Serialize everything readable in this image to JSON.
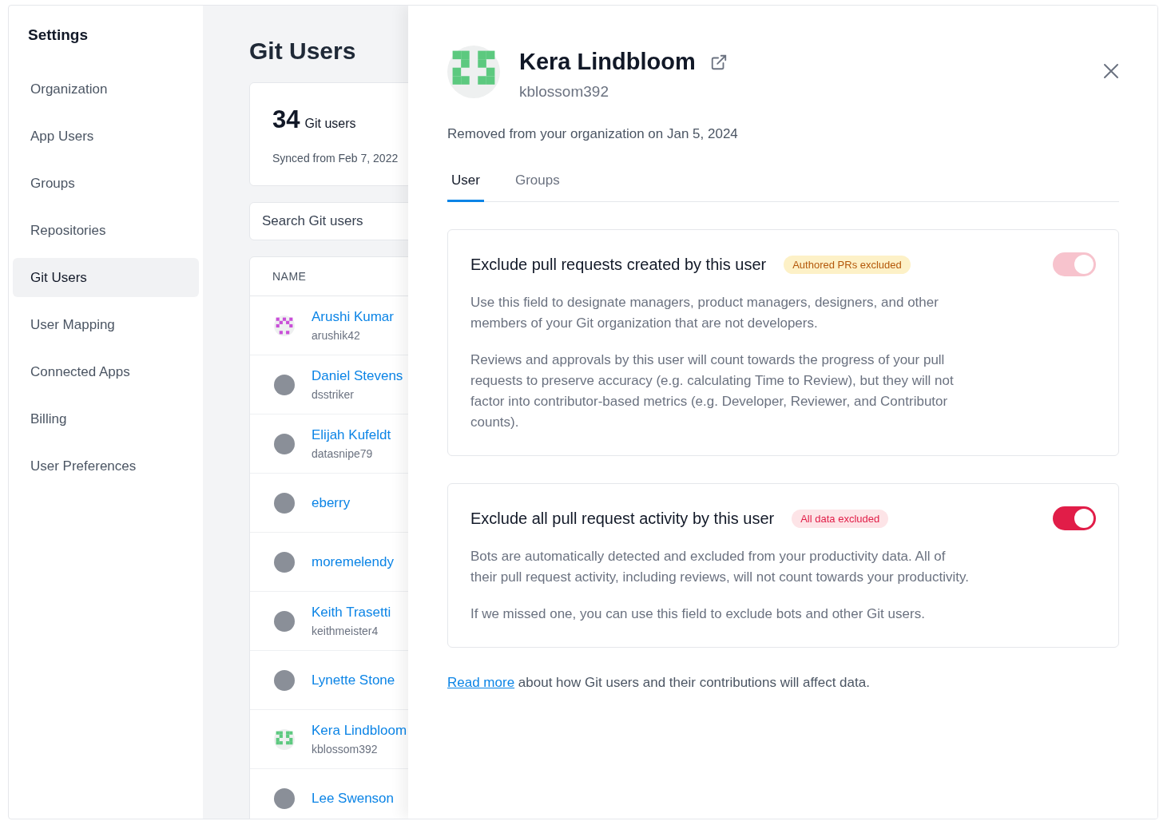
{
  "sidebar": {
    "title": "Settings",
    "items": [
      {
        "label": "Organization",
        "selected": false
      },
      {
        "label": "App Users",
        "selected": false
      },
      {
        "label": "Groups",
        "selected": false
      },
      {
        "label": "Repositories",
        "selected": false
      },
      {
        "label": "Git Users",
        "selected": true
      },
      {
        "label": "User Mapping",
        "selected": false
      },
      {
        "label": "Connected Apps",
        "selected": false
      },
      {
        "label": "Billing",
        "selected": false
      },
      {
        "label": "User Preferences",
        "selected": false
      }
    ]
  },
  "main": {
    "title": "Git Users",
    "stats": {
      "count": "34",
      "count_label": "Git users",
      "synced": "Synced from Feb 7, 2022"
    },
    "search": {
      "placeholder": "Search Git users"
    },
    "table": {
      "columns": [
        "NAME"
      ],
      "rows": [
        {
          "name": "Arushi Kumar",
          "username": "arushik42",
          "kind": "identicon",
          "color": "#c94fd8"
        },
        {
          "name": "Daniel Stevens",
          "username": "dsstriker",
          "kind": "photo"
        },
        {
          "name": "Elijah Kufeldt",
          "username": "datasnipe79",
          "kind": "photo"
        },
        {
          "name": "eberry",
          "kind": "photo"
        },
        {
          "name": "moremelendy",
          "kind": "photo"
        },
        {
          "name": "Keith Trasetti",
          "username": "keithmeister4",
          "kind": "photo"
        },
        {
          "name": "Lynette Stone",
          "kind": "photo"
        },
        {
          "name": "Kera Lindbloom",
          "username": "kblossom392",
          "kind": "identicon",
          "color": "#5cc97f"
        },
        {
          "name": "Lee Swenson",
          "kind": "photo"
        }
      ]
    }
  },
  "drawer": {
    "name": "Kera Lindbloom",
    "username": "kblossom392",
    "status": "Removed from your organization on Jan 5, 2024",
    "tabs": [
      {
        "label": "User",
        "selected": true
      },
      {
        "label": "Groups",
        "selected": false
      }
    ],
    "settings": [
      {
        "title": "Exclude pull requests created by this user",
        "badge": {
          "text": "Authored PRs excluded",
          "kind": "warning"
        },
        "on": true,
        "disabled": true,
        "paragraphs": [
          "Use this field to designate managers, product managers, designers, and other members of your Git organization that are not developers.",
          "Reviews and approvals by this user will count towards the progress of your pull requests to preserve accuracy (e.g. calculating Time to Review), but they will not factor into contributor-based metrics (e.g. Developer, Reviewer, and Contributor counts)."
        ]
      },
      {
        "title": "Exclude all pull request activity by this user",
        "badge": {
          "text": "All data excluded",
          "kind": "danger"
        },
        "on": true,
        "disabled": false,
        "paragraphs": [
          "Bots are automatically detected and excluded from your productivity data. All of their pull request activity, including reviews, will not count towards your productivity.",
          "If we missed one, you can use this field to exclude bots and other Git users."
        ]
      }
    ],
    "footer": {
      "link": "Read more",
      "text": "about how Git users and their contributions will affect data."
    }
  }
}
